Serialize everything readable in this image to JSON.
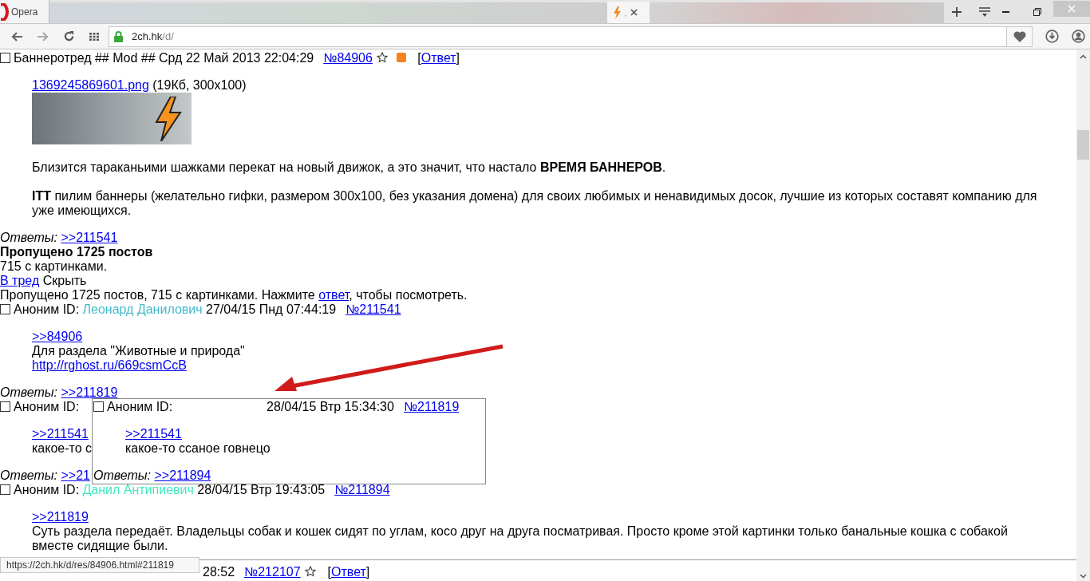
{
  "browser": {
    "opera_label": "Opera",
    "active_tab": {
      "title": ",",
      "selected": true
    },
    "address": {
      "host": "2ch.hk",
      "path": "/d/"
    }
  },
  "op": {
    "checked": false,
    "subject": "Баннеротред ## Mod ## Срд 22 Май 2013 22:04:29",
    "number": "№84906",
    "reply_open": "[",
    "reply": "Ответ",
    "reply_close": "]",
    "file": {
      "name": "1369245869601.png",
      "info": "(19Кб, 300x100)"
    },
    "paragraphs": [
      "Близится тараканьими шажками перекат на новый движок, а это значит, что настало **ВРЕМЯ БАННЕРОВ**.",
      "**ITT** пилим баннеры (желательно гифки, размером 300x100, без указания домена) для своих любимых и ненавидимых досок, лучшие из которых составят компанию для уже имеющихся."
    ],
    "replies": {
      "label": "Ответы:",
      "links": [
        ">>211541"
      ]
    }
  },
  "omitted": {
    "title": "Пропущено 1725 постов",
    "images": "715 с картинками.",
    "to_thread": "В тред",
    "hide": "Скрыть",
    "notice_before": "Пропущено 1725 постов, 715 с картинками. Нажмите ",
    "notice_link": "ответ",
    "notice_after": ", чтобы посмотреть."
  },
  "posts": [
    {
      "checked": false,
      "label": "Аноним ID:",
      "id_name": "Леонард Данилович",
      "color": "#44bbcc",
      "date": "27/04/15 Пнд 07:44:19",
      "number": "№211541",
      "body": [
        {
          "kind": "link",
          "text": ">>84906"
        },
        {
          "kind": "text",
          "text": "Для раздела \"Животные и природа\""
        },
        {
          "kind": "link",
          "text": "http://rghost.ru/669csmCcB"
        }
      ],
      "replies": {
        "label": "Ответы:",
        "links": [
          ">>211819"
        ]
      }
    },
    {
      "label": "Аноним ID:",
      "body": [
        {
          "kind": "link",
          "text": ">>211541"
        },
        {
          "kind": "text",
          "text": "какое-то с"
        }
      ],
      "replies": {
        "label": "Ответы:",
        "links": [
          ">>21"
        ]
      },
      "checked": false,
      "popup": {
        "checked": false,
        "label": "Аноним ID:",
        "date": "28/04/15 Втр 15:34:30",
        "number": "№211819",
        "body": [
          {
            "kind": "link",
            "text": ">>211541"
          },
          {
            "kind": "text",
            "text": "какое-то ссаное говнецо"
          }
        ],
        "replies": {
          "label": "Ответы:",
          "links": [
            ">>211894"
          ]
        }
      }
    },
    {
      "checked": false,
      "label": "Аноним ID:",
      "id_name": "Данил Антипиевич",
      "color": "#40e8c0",
      "date": "28/04/15 Втр 19:43:05",
      "number": "№211894",
      "body": [
        {
          "kind": "link",
          "text": ">>211819"
        },
        {
          "kind": "text",
          "text": "Суть раздела передаёт. Владельцы собак и кошек сидят по углам, косо друг на друга посматривая. Просто кроме этой картинки только банальные кошка с собакой вместе сидящие были."
        }
      ]
    }
  ],
  "next_post": {
    "time": "28:52",
    "number": "№212107",
    "reply_open": "[",
    "reply": "Ответ",
    "reply_close": "]"
  },
  "status_url": "https://2ch.hk/d/res/84906.html#211819"
}
